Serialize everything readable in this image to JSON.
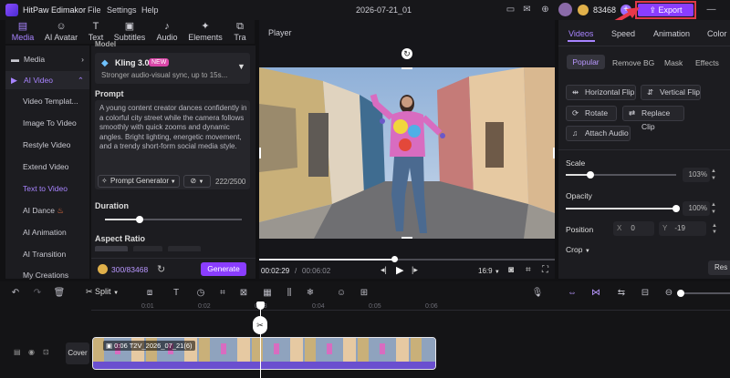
{
  "app": {
    "title": "HitPaw Edimakor",
    "menu": [
      "File",
      "Settings",
      "Help"
    ],
    "project_name": "2026-07-21_01",
    "credits": "83468",
    "export_label": "Export"
  },
  "top_tabs": [
    {
      "label": "Media",
      "icon": "media-icon"
    },
    {
      "label": "AI Avatar",
      "icon": "avatar-icon"
    },
    {
      "label": "Text",
      "icon": "text-icon"
    },
    {
      "label": "Subtitles",
      "icon": "subtitles-icon"
    },
    {
      "label": "Audio",
      "icon": "audio-icon"
    },
    {
      "label": "Elements",
      "icon": "elements-icon"
    },
    {
      "label": "Tra",
      "icon": "transition-icon"
    }
  ],
  "sidebar": {
    "groups": [
      {
        "label": "Media"
      },
      {
        "label": "AI Video"
      }
    ],
    "items": [
      "Video Templat...",
      "Image To Video",
      "Restyle Video",
      "Extend Video",
      "Text to Video",
      "AI Dance",
      "AI Animation",
      "AI Transition",
      "My Creations"
    ],
    "active_item": "Text to Video"
  },
  "gen_panel": {
    "model_label": "Model",
    "model_name": "Kling 3.0",
    "model_badge": "NEW",
    "model_desc": "Stronger audio-visual sync, up to 15s...",
    "prompt_label": "Prompt",
    "prompt_text": "A young content creator dances confidently in a colorful city street while the camera follows smoothly with quick zooms and dynamic angles. Bright lighting, energetic movement, and a trendy short-form social media style.",
    "prompt_generator": "Prompt Generator",
    "char_count": "222/2500",
    "duration_label": "Duration",
    "duration_fraction": 0.25,
    "aspect_label": "Aspect Ratio",
    "cost_text": "300/83468",
    "generate_label": "Generate"
  },
  "player": {
    "title": "Player",
    "current_time": "00:02:29",
    "total_time": "00:06:02",
    "ratio": "16:9",
    "progress_fraction": 0.46
  },
  "right_panel": {
    "tabs": [
      "Videos",
      "Speed",
      "Animation",
      "Color"
    ],
    "subtabs": [
      "Popular",
      "Remove BG",
      "Mask",
      "Effects"
    ],
    "buttons": [
      "Horizontal Flip",
      "Vertical Flip",
      "Rotate",
      "Replace Clip",
      "Attach Audio"
    ],
    "scale_label": "Scale",
    "scale_value": "103%",
    "scale_fraction": 0.22,
    "opacity_label": "Opacity",
    "opacity_value": "100%",
    "opacity_fraction": 1.0,
    "position_label": "Position",
    "pos_x_label": "X",
    "pos_x": "0",
    "pos_y_label": "Y",
    "pos_y": "-19",
    "crop_label": "Crop",
    "reset_label": "Res"
  },
  "timeline": {
    "split_label": "Split",
    "ruler_marks": [
      "0:01",
      "0:02",
      "0:03",
      "0:04",
      "0:05",
      "0:06"
    ],
    "cover_label": "Cover",
    "clip_label": "0:06 T2V_2026_07_21(6)"
  }
}
